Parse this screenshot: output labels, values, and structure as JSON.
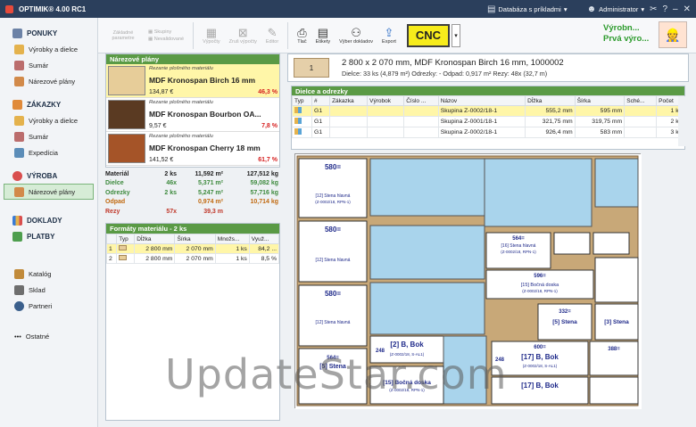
{
  "app": {
    "title": "OPTIMIK® 4.00 RC1"
  },
  "titlebar": {
    "database": "Databáza s príkladmi",
    "user": "Administrator"
  },
  "sidebar": {
    "sections": [
      {
        "label": "PONUKY",
        "items": [
          "Výrobky a dielce",
          "Sumár",
          "Nárezové plány"
        ]
      },
      {
        "label": "ZÁKAZKY",
        "items": [
          "Výrobky a dielce",
          "Sumár",
          "Expedícia"
        ]
      },
      {
        "label": "VÝROBA",
        "items": [
          "Nárezové plány"
        ]
      },
      {
        "label": "DOKLADY",
        "items": []
      },
      {
        "label": "PLATBY",
        "items": []
      }
    ],
    "bottom": [
      "Katalóg",
      "Sklad",
      "Partneri"
    ],
    "more": "Ostatné",
    "active_index": 6
  },
  "toolbar": {
    "btn_basic": "Základné parametre",
    "btn_groups": "Skupiny",
    "btn_unused": "Nevalidované",
    "btn_calc": "Výpočty",
    "btn_clear": "Zruš výpočty",
    "btn_editor": "Editor",
    "btn_print": "Tlač",
    "btn_labels": "Etikety",
    "btn_select": "Výber dokladov",
    "btn_export": "Export",
    "btn_cnc": "CNC"
  },
  "module": {
    "line1": "Výrobn...",
    "line2": "Prvá výro..."
  },
  "plans": {
    "header": "Nárezové plány",
    "cards": [
      {
        "sub": "Rezanie plošného materiálu",
        "name": "MDF Kronospan Birch 16 mm",
        "price": "134,87 €",
        "pct": "46,3 %",
        "color": "#e7cd99"
      },
      {
        "sub": "Rezanie plošného materiálu",
        "name": "MDF Kronospan Bourbon OA...",
        "price": "9,57 €",
        "pct": "7,8 %",
        "color": "#5a3a22"
      },
      {
        "sub": "Rezanie plošného materiálu",
        "name": "MDF Kronospan Cherry 18 mm",
        "price": "141,52 €",
        "pct": "61,7 %",
        "color": "#a55428"
      }
    ]
  },
  "stats": [
    {
      "label": "Materiál",
      "count": "2 ks",
      "area": "11,592 m²",
      "weight": "127,512 kg",
      "cls": "blk"
    },
    {
      "label": "Dielce",
      "count": "46x",
      "area": "5,371 m²",
      "weight": "59,082 kg",
      "cls": "grn"
    },
    {
      "label": "Odrezky",
      "count": "2 ks",
      "area": "5,247 m²",
      "weight": "57,716 kg",
      "cls": "grn"
    },
    {
      "label": "Odpad",
      "count": "",
      "area": "0,974 m²",
      "weight": "10,714 kg",
      "cls": "orn"
    },
    {
      "label": "Rezy",
      "count": "57x",
      "area": "39,3 m",
      "weight": "",
      "cls": "red"
    }
  ],
  "formats": {
    "header": "Formáty materiálu - 2 ks",
    "columns": [
      "",
      "Typ",
      "Dĺžka",
      "Šírka",
      "Množs...",
      "Využ..."
    ],
    "rows": [
      [
        "1",
        "",
        "2 800 mm",
        "2 070 mm",
        "1 ks",
        "84,2 ..."
      ],
      [
        "2",
        "",
        "2 800 mm",
        "2 070 mm",
        "1 ks",
        "8,5 %"
      ]
    ]
  },
  "detail": {
    "thumb": "1",
    "title": "2 800 x 2 070 mm, MDF Kronospan Birch 16 mm, 1000002",
    "summary": "Dielce: 33 ks (4,879 m²)   Odrezky: -   Odpad: 0,917 m²   Rezy: 48x (32,7 m)"
  },
  "parts": {
    "header": "Dielce a odrezky",
    "columns": [
      "Typ",
      "#",
      "Zákazka",
      "Výrobok",
      "Číslo ...",
      "Názov",
      "Dĺžka",
      "Šírka",
      "Sché...",
      "Počet"
    ],
    "rows": [
      [
        "",
        "G1",
        "",
        "",
        "",
        "Skupina Z-0002/18-1",
        "555,2 mm",
        "595 mm",
        "",
        "1 ks"
      ],
      [
        "",
        "G1",
        "",
        "",
        "",
        "Skupina Z-0001/18-1",
        "321,75 mm",
        "319,75 mm",
        "",
        "2 ks"
      ],
      [
        "",
        "G1",
        "",
        "",
        "",
        "Skupina Z-0002/18-1",
        "926,4 mm",
        "583 mm",
        "",
        "3 ks"
      ]
    ]
  },
  "layout_labels": {
    "p1": "580=",
    "p1v": "496=",
    "p1a": "[12] Stena hlavná",
    "p1b": "(Z-0002/18, RPN-1)",
    "b1": "[2] B, Bok",
    "b1s": "(Z-0002/18, S-AL1)",
    "b2": "[17] B, Bok",
    "b2s": "(Z-0002/18, S-AL1)",
    "s1": "[16] Stena hlavná",
    "s1s": "(Z-0002/18, RPN-1)",
    "bd": "[15] Bočná doska",
    "bds": "(Z-0002/18, RPN-1)",
    "st": "[5] Stena",
    "st2": "[3] Stena",
    "d1": "596=",
    "d2": "564=",
    "d3": "248",
    "d4": "388=",
    "d5": "332=",
    "d6": "600="
  },
  "watermark": "UpdateStar.com"
}
